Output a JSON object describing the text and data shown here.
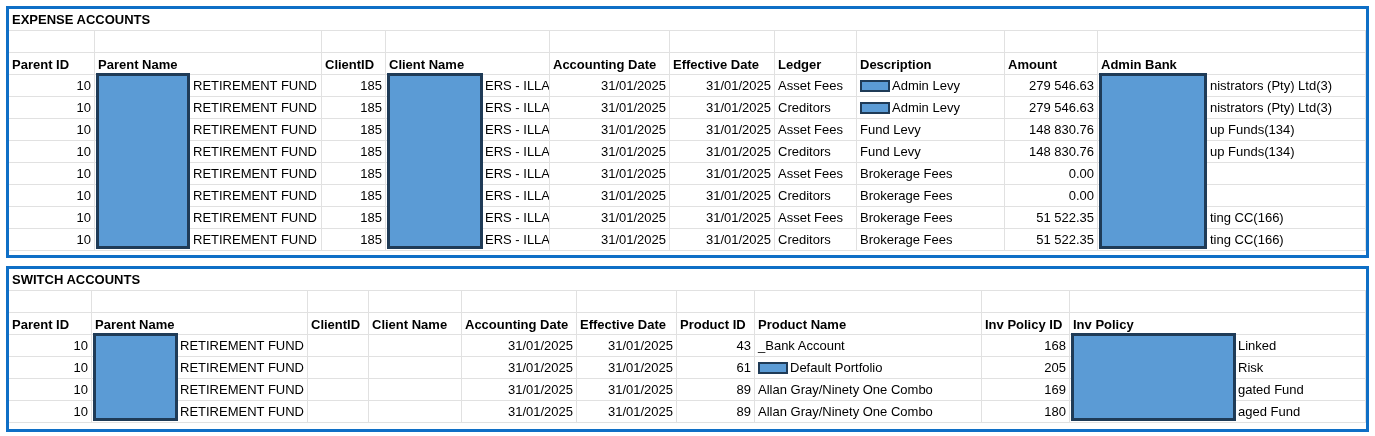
{
  "tables": [
    {
      "title": "EXPENSE ACCOUNTS",
      "columns": [
        {
          "label": "Parent ID",
          "kind": "number",
          "redacted": false
        },
        {
          "label": "Parent Name",
          "kind": "text",
          "redacted": true
        },
        {
          "label": "ClientID",
          "kind": "number",
          "redacted": false
        },
        {
          "label": "Client Name",
          "kind": "text",
          "redacted": true
        },
        {
          "label": "Accounting Date",
          "kind": "number",
          "redacted": false
        },
        {
          "label": "Effective Date",
          "kind": "number",
          "redacted": false
        },
        {
          "label": "Ledger",
          "kind": "text",
          "redacted": false
        },
        {
          "label": "Description",
          "kind": "text",
          "redacted": false
        },
        {
          "label": "Amount",
          "kind": "number",
          "redacted": false
        },
        {
          "label": "Admin Bank",
          "kind": "text",
          "redacted": true
        }
      ],
      "rows": [
        [
          "10",
          "RETIREMENT FUND",
          "185",
          "ERS - ILLA",
          "31/01/2025",
          "31/01/2025",
          "Asset Fees",
          {
            "text": "Admin Levy",
            "redacted": true
          },
          "279 546.63",
          "nistrators (Pty) Ltd(3)"
        ],
        [
          "10",
          "RETIREMENT FUND",
          "185",
          "ERS - ILLA",
          "31/01/2025",
          "31/01/2025",
          "Creditors",
          {
            "text": "Admin Levy",
            "redacted": true
          },
          "279 546.63",
          "nistrators (Pty) Ltd(3)"
        ],
        [
          "10",
          "RETIREMENT FUND",
          "185",
          "ERS - ILLA",
          "31/01/2025",
          "31/01/2025",
          "Asset Fees",
          "Fund Levy",
          "148 830.76",
          "up Funds(134)"
        ],
        [
          "10",
          "RETIREMENT FUND",
          "185",
          "ERS - ILLA",
          "31/01/2025",
          "31/01/2025",
          "Creditors",
          "Fund Levy",
          "148 830.76",
          "up Funds(134)"
        ],
        [
          "10",
          "RETIREMENT FUND",
          "185",
          "ERS - ILLA",
          "31/01/2025",
          "31/01/2025",
          "Asset Fees",
          "Brokerage Fees",
          "0.00",
          ""
        ],
        [
          "10",
          "RETIREMENT FUND",
          "185",
          "ERS - ILLA",
          "31/01/2025",
          "31/01/2025",
          "Creditors",
          "Brokerage Fees",
          "0.00",
          ""
        ],
        [
          "10",
          "RETIREMENT FUND",
          "185",
          "ERS - ILLA",
          "31/01/2025",
          "31/01/2025",
          "Asset Fees",
          "Brokerage Fees",
          "51 522.35",
          "ting CC(166)"
        ],
        [
          "10",
          "RETIREMENT FUND",
          "185",
          "ERS - ILLA",
          "31/01/2025",
          "31/01/2025",
          "Creditors",
          "Brokerage Fees",
          "51 522.35",
          "ting CC(166)"
        ]
      ]
    },
    {
      "title": "SWITCH ACCOUNTS",
      "columns": [
        {
          "label": "Parent ID",
          "kind": "number",
          "redacted": false
        },
        {
          "label": "Parent Name",
          "kind": "text",
          "redacted": true
        },
        {
          "label": "ClientID",
          "kind": "number",
          "redacted": false
        },
        {
          "label": "Client Name",
          "kind": "text",
          "redacted": false
        },
        {
          "label": "Accounting Date",
          "kind": "number",
          "redacted": false
        },
        {
          "label": "Effective Date",
          "kind": "number",
          "redacted": false
        },
        {
          "label": "Product ID",
          "kind": "number",
          "redacted": false
        },
        {
          "label": "Product Name",
          "kind": "text",
          "redacted": false
        },
        {
          "label": "Inv Policy ID",
          "kind": "number",
          "redacted": false
        },
        {
          "label": "Inv Policy",
          "kind": "text",
          "redacted": true
        }
      ],
      "rows": [
        [
          "10",
          "RETIREMENT FUND",
          "",
          "",
          "31/01/2025",
          "31/01/2025",
          "43",
          "_Bank Account",
          "168",
          "Linked"
        ],
        [
          "10",
          "RETIREMENT FUND",
          "",
          "",
          "31/01/2025",
          "31/01/2025",
          "61",
          {
            "text": "Default Portfolio",
            "redacted": true
          },
          "205",
          "Risk"
        ],
        [
          "10",
          "RETIREMENT FUND",
          "",
          "",
          "31/01/2025",
          "31/01/2025",
          "89",
          "Allan Gray/Ninety One Combo",
          "169",
          "gated Fund"
        ],
        [
          "10",
          "RETIREMENT FUND",
          "",
          "",
          "31/01/2025",
          "31/01/2025",
          "89",
          "Allan Gray/Ninety One Combo",
          "180",
          "aged Fund"
        ]
      ]
    }
  ]
}
